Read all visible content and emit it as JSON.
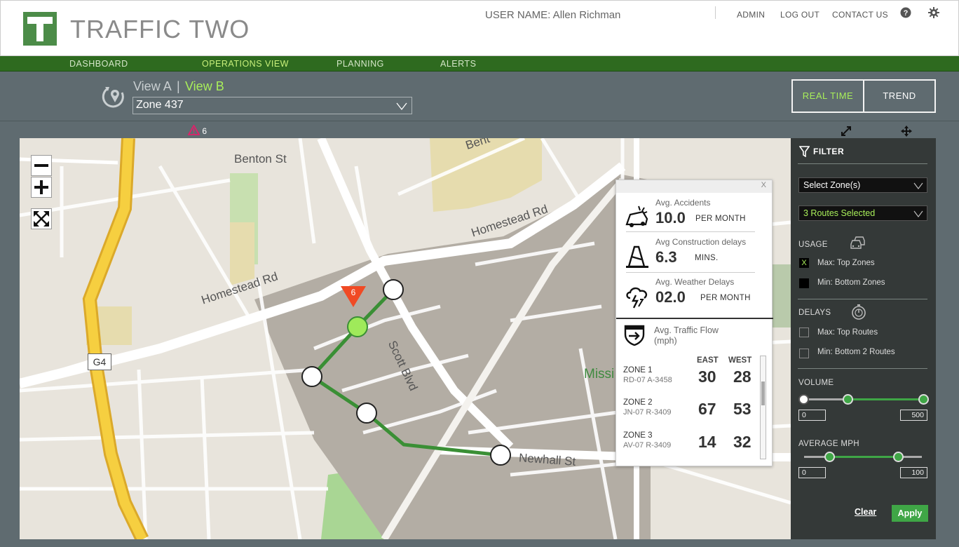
{
  "app": {
    "title": "TRAFFIC TWO",
    "user_label": "USER NAME: Allen Richman",
    "links": [
      "ADMIN",
      "LOG OUT",
      "CONTACT US"
    ]
  },
  "nav": {
    "items": [
      "DASHBOARD",
      "OPERATIONS  VIEW",
      "PLANNING",
      "ALERTS"
    ],
    "active": "OPERATIONS  VIEW"
  },
  "toolbar": {
    "view_a": "View A",
    "separator": "|",
    "view_b": "View B",
    "zone_value": "Zone 437",
    "mode_real_time": "REAL TIME",
    "mode_trend": "TREND",
    "alert_count": "6"
  },
  "map": {
    "streets": {
      "benton_top": "Benton St",
      "benton_cut": "Bent",
      "homestead_left": "Homestead Rd",
      "homestead_right": "Homestead Rd",
      "scott": "Scott Blvd",
      "newhall": "Newhall St",
      "mission_partial": "Missi"
    },
    "route_badge": "G4",
    "alert_pin_count": "6"
  },
  "popup": {
    "close": "X",
    "stats": [
      {
        "label": "Avg. Accidents",
        "value": "10.0",
        "unit": "PER MONTH",
        "icon": "crash-icon"
      },
      {
        "label": "Avg Construction delays",
        "value": "6.3",
        "unit": "MINS.",
        "icon": "cone-icon"
      },
      {
        "label": "Avg. Weather Delays",
        "value": "02.0",
        "unit": "PER MONTH",
        "icon": "storm-cloud-icon"
      }
    ],
    "flow_label_line1": "Avg. Traffic Flow",
    "flow_label_line2": "(mph)",
    "col_east": "EAST",
    "col_west": "WEST",
    "zones": [
      {
        "name": "ZONE 1",
        "code": "RD-07 A-3458",
        "east": "30",
        "west": "28"
      },
      {
        "name": "ZONE 2",
        "code": "JN-07 R-3409",
        "east": "67",
        "west": "53"
      },
      {
        "name": "ZONE 3",
        "code": "AV-07 R-3409",
        "east": "14",
        "west": "32"
      }
    ]
  },
  "filter": {
    "title": "FILTER",
    "zones_select": "Select Zone(s)",
    "routes_select": "3  Routes Selected",
    "usage_label": "USAGE",
    "usage_max": "Max: Top Zones",
    "usage_min": "Min: Bottom Zones",
    "delays_label": "DELAYS",
    "delays_max": "Max: Top Routes",
    "delays_min": "Min: Bottom 2 Routes",
    "volume_label": "VOLUME",
    "volume_min": "0",
    "volume_max": "500",
    "mph_label": "AVERAGE MPH",
    "mph_min": "0",
    "mph_max": "100",
    "clear": "Clear",
    "apply": "Apply",
    "check_mark": "X"
  },
  "colors": {
    "brand_green": "#4c8c48",
    "nav_green": "#2e6a1f",
    "accent_lime": "#a8ee5a",
    "route_green": "#3a8f35",
    "alert_red": "#f04a24"
  }
}
